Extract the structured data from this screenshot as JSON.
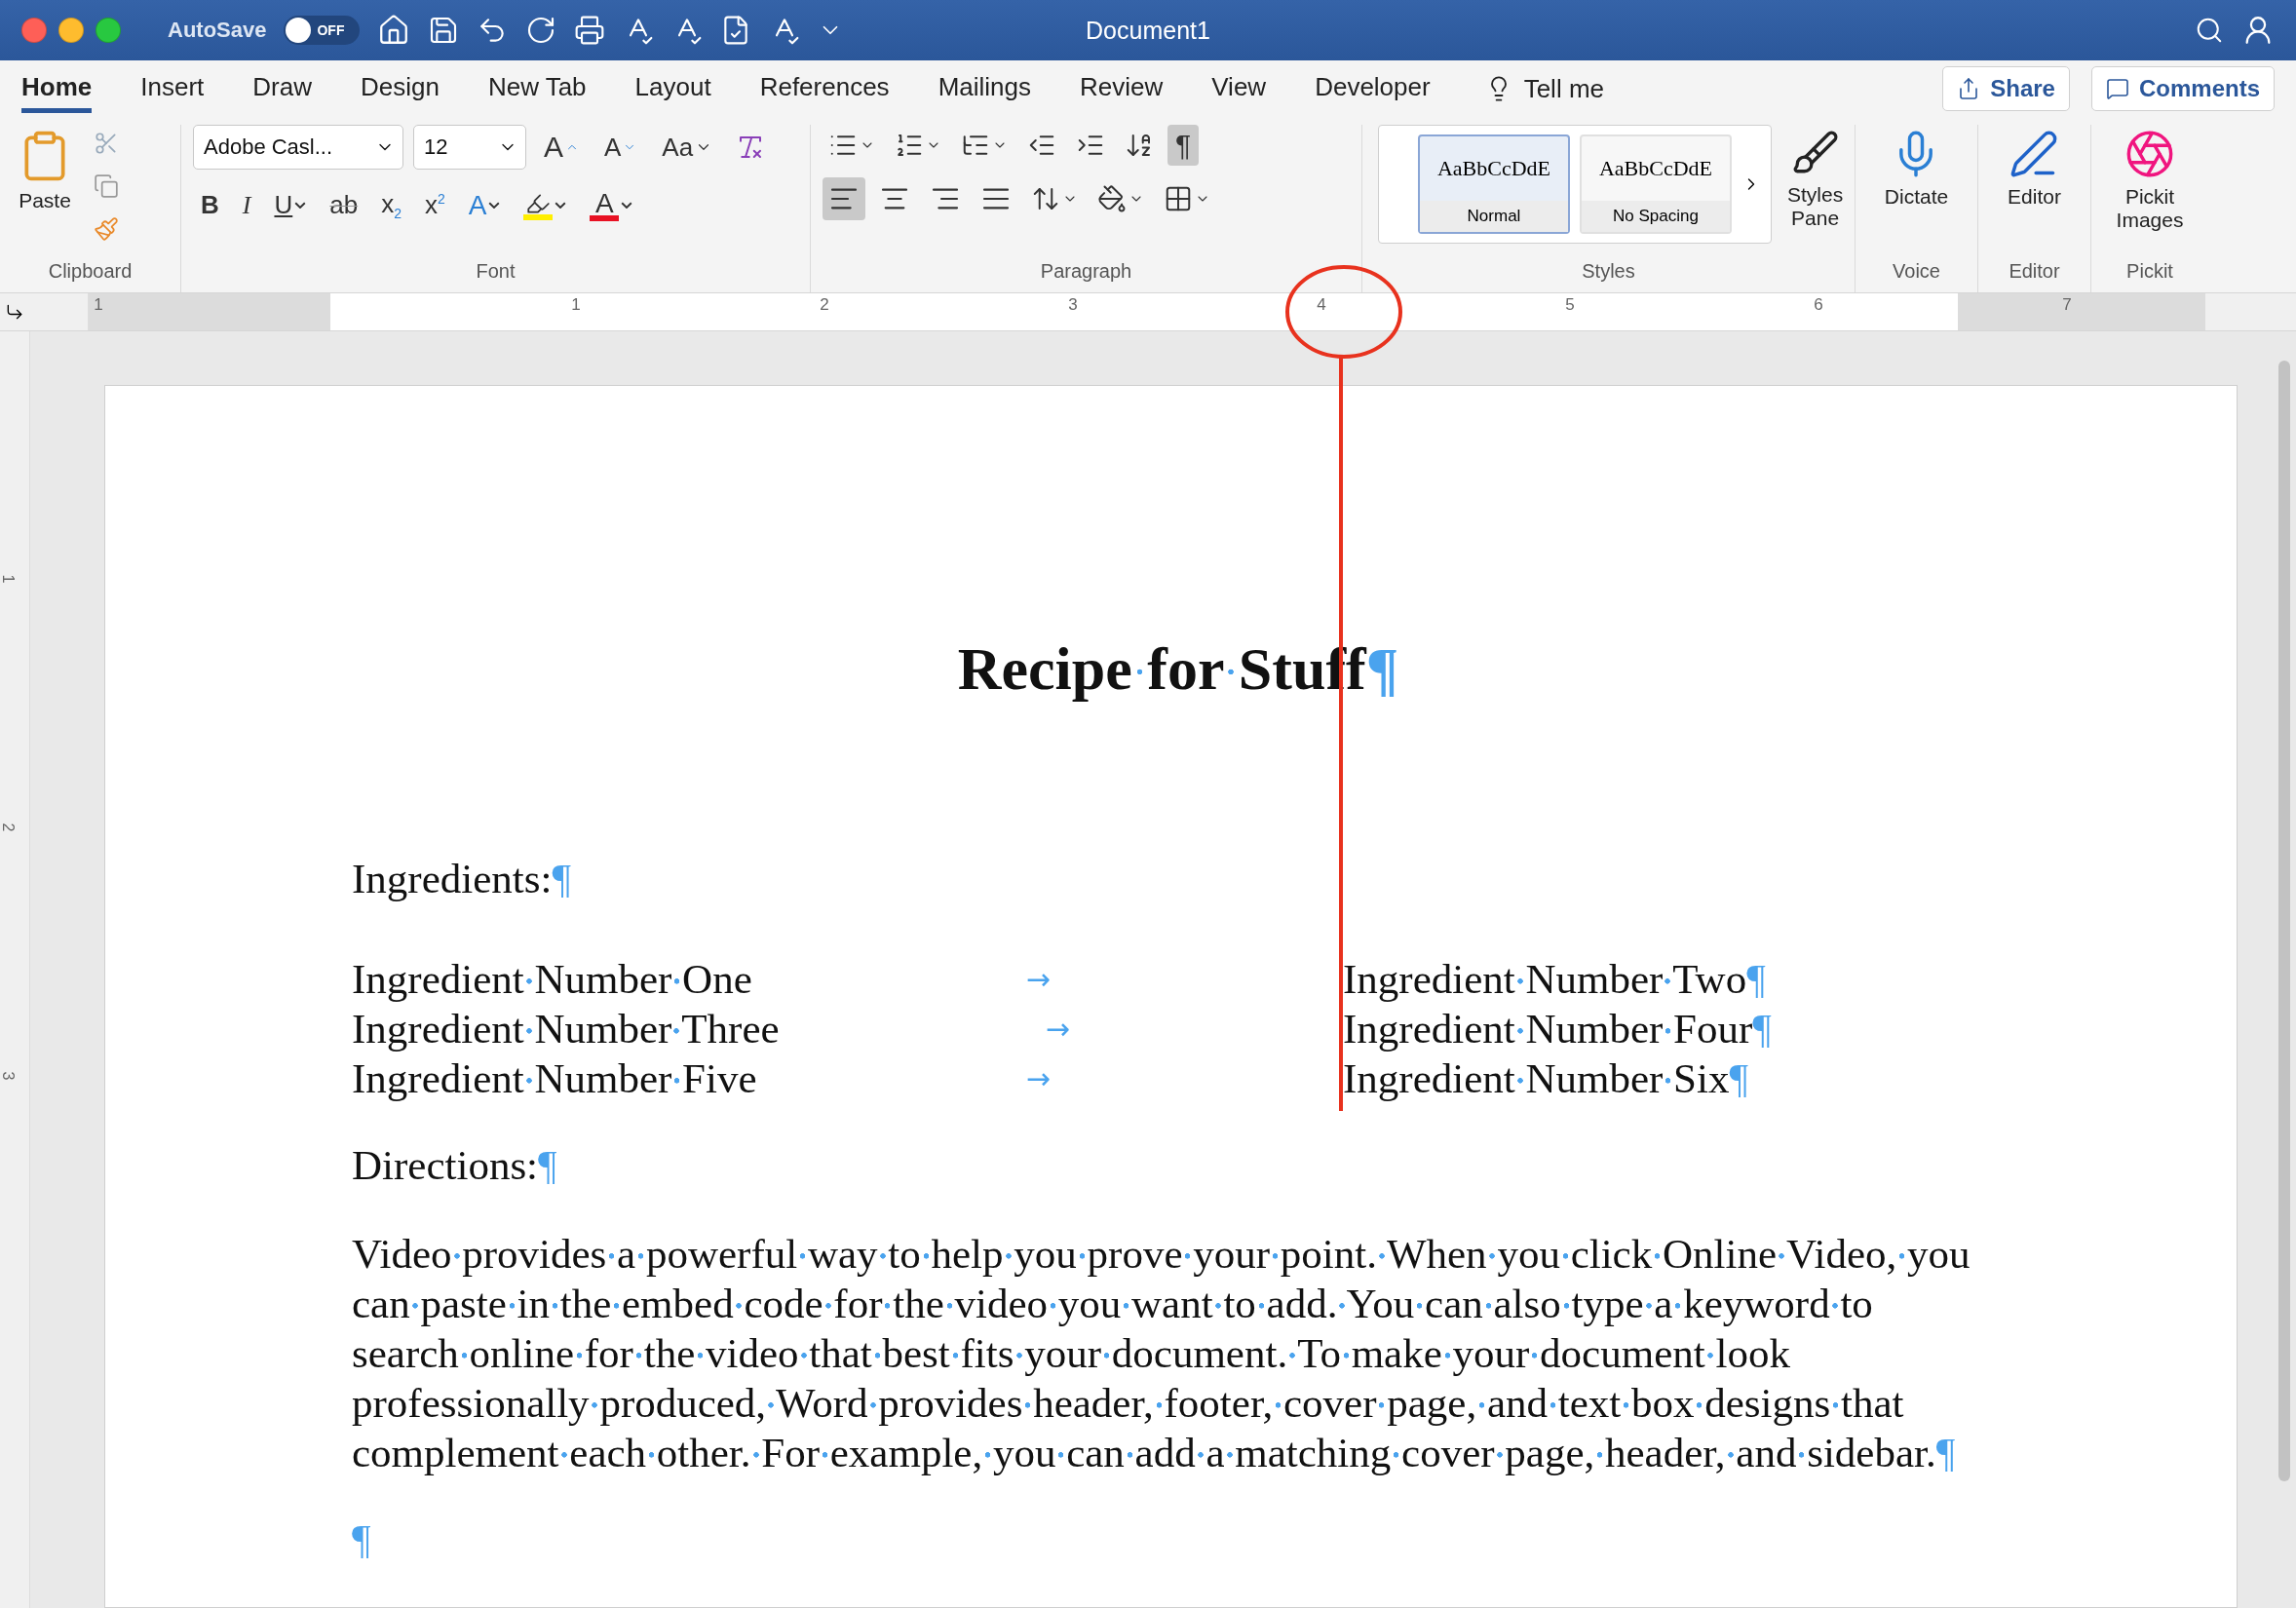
{
  "title_bar": {
    "autosave_label": "AutoSave",
    "autosave": {
      "on": false,
      "label": "OFF"
    },
    "title": "Document1"
  },
  "tabs": [
    {
      "label": "Home",
      "selected": true
    },
    {
      "label": "Insert",
      "selected": false
    },
    {
      "label": "Draw",
      "selected": false
    },
    {
      "label": "Design",
      "selected": false
    },
    {
      "label": "New Tab",
      "selected": false
    },
    {
      "label": "Layout",
      "selected": false
    },
    {
      "label": "References",
      "selected": false
    },
    {
      "label": "Mailings",
      "selected": false
    },
    {
      "label": "Review",
      "selected": false
    },
    {
      "label": "View",
      "selected": false
    },
    {
      "label": "Developer",
      "selected": false
    }
  ],
  "tell_me": "Tell me",
  "share": "Share",
  "comments": "Comments",
  "ribbon": {
    "clipboard": {
      "paste": "Paste",
      "label": "Clipboard"
    },
    "font": {
      "font_name": "Adobe Casl...",
      "font_size": "12",
      "grow": "A",
      "shrink": "A",
      "case_button": "Aa",
      "label": "Font",
      "format_buttons": [
        {
          "kind": "bold",
          "label": "B"
        },
        {
          "kind": "italic",
          "label": "I"
        },
        {
          "kind": "underline",
          "label": "U"
        },
        {
          "kind": "strike",
          "label": "ab"
        },
        {
          "kind": "sub",
          "label": "x$_{2}$"
        },
        {
          "kind": "sup",
          "label": "x$^{2}$"
        }
      ],
      "color_buttons": [
        {
          "kind": "effects",
          "label": "A",
          "color": "#2a7fd4"
        },
        {
          "kind": "highlight",
          "color": "#ffef00"
        },
        {
          "kind": "font-color",
          "label": "A",
          "color": "#e81123"
        }
      ]
    },
    "paragraph": {
      "label": "Paragraph",
      "show_marks": {
        "label": "¶",
        "selected": true
      },
      "alignments": [
        {
          "kind": "left",
          "selected": true
        },
        {
          "kind": "center",
          "selected": false
        },
        {
          "kind": "right",
          "selected": false
        },
        {
          "kind": "justify",
          "selected": false
        }
      ]
    },
    "styles": {
      "label": "Styles",
      "pane": "Styles Pane",
      "items": [
        {
          "sample": "AaBbCcDdE",
          "name": "Normal",
          "selected": true
        },
        {
          "sample": "AaBbCcDdE",
          "name": "No Spacing",
          "selected": false
        }
      ]
    },
    "voice": {
      "button": "Dictate",
      "label": "Voice"
    },
    "editor": {
      "button": "Editor",
      "label": "Editor"
    },
    "pickit": {
      "button": "Pickit Images",
      "label": "Pickit"
    }
  },
  "ruler": {
    "labels": [
      "1",
      "1",
      "2",
      "3",
      "4",
      "5",
      "6",
      "7"
    ]
  },
  "vertical_ruler": {
    "labels": [
      "1",
      "2",
      "3"
    ]
  },
  "document": {
    "show_marks": true,
    "blocks": [
      {
        "kind": "heading",
        "text": "Recipe for Stuff",
        "mark": "¶"
      },
      {
        "kind": "label",
        "text": "Ingredients:",
        "mark": "¶"
      },
      {
        "kind": "tab_row",
        "left": "Ingredient Number One",
        "tab_mark": "→",
        "right": "Ingredient Number Two",
        "mark": "¶"
      },
      {
        "kind": "tab_row",
        "left": "Ingredient Number Three",
        "tab_mark": "→",
        "right": "Ingredient Number Four",
        "mark": "¶"
      },
      {
        "kind": "tab_row",
        "left": "Ingredient Number Five",
        "tab_mark": "→",
        "right": "Ingredient Number Six",
        "mark": "¶"
      },
      {
        "kind": "label",
        "text": "Directions:",
        "mark": "¶"
      },
      {
        "kind": "body",
        "text": "Video provides a powerful way to help you prove your point. When you click Online Video, you can paste in the embed code for the video you want to add. You can also type a keyword to search online for the video that best fits your document. To make your document look professionally produced, Word provides header, footer, cover page, and text box designs that complement each other. For example, you can add a matching cover page, header, and sidebar.",
        "mark": "¶"
      },
      {
        "kind": "empty",
        "mark": "¶"
      }
    ]
  }
}
